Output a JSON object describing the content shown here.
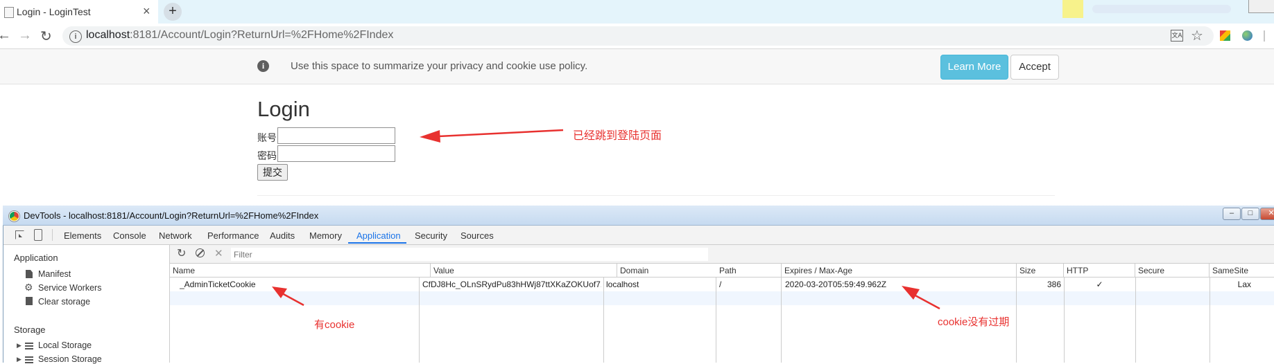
{
  "browser": {
    "tab_title": "Login - LoginTest",
    "tab_close": "×",
    "new_tab": "+",
    "url_host": "localhost",
    "url_rest": ":8181/Account/Login?ReturnUrl=%2FHome%2FIndex"
  },
  "cookie_consent": {
    "text": "Use this space to summarize your privacy and cookie use policy.",
    "learn_more": "Learn More",
    "accept": "Accept"
  },
  "login": {
    "heading": "Login",
    "account_label": "账号",
    "password_label": "密码",
    "submit_label": "提交"
  },
  "annotations": {
    "redirect": "已经跳到登陆页面",
    "has_cookie": "有cookie",
    "not_expired": "cookie没有过期"
  },
  "devtools": {
    "title": "DevTools - localhost:8181/Account/Login?ReturnUrl=%2FHome%2FIndex",
    "tabs": [
      "Elements",
      "Console",
      "Network",
      "Performance",
      "Audits",
      "Memory",
      "Application",
      "Security",
      "Sources"
    ],
    "active_tab": "Application",
    "sidebar": {
      "application_header": "Application",
      "manifest": "Manifest",
      "service_workers": "Service Workers",
      "clear_storage": "Clear storage",
      "storage_header": "Storage",
      "local_storage": "Local Storage",
      "session_storage": "Session Storage"
    },
    "filter_placeholder": "Filter",
    "columns": [
      "Name",
      "Value",
      "Domain",
      "Path",
      "Expires / Max-Age",
      "Size",
      "HTTP",
      "Secure",
      "SameSite"
    ],
    "rows": [
      {
        "name": "_AdminTicketCookie",
        "value": "CfDJ8Hc_OLnSRydPu83hHWj87ttXKaZOKUof7...",
        "domain": "localhost",
        "path": "/",
        "expires": "2020-03-20T05:59:49.962Z",
        "size": "386",
        "http": "✓",
        "secure": "",
        "samesite": "Lax"
      }
    ]
  },
  "colors": {
    "accent": "#1a73e8",
    "annotation_red": "#e8312f",
    "learn_more_bg": "#5bc0de"
  }
}
